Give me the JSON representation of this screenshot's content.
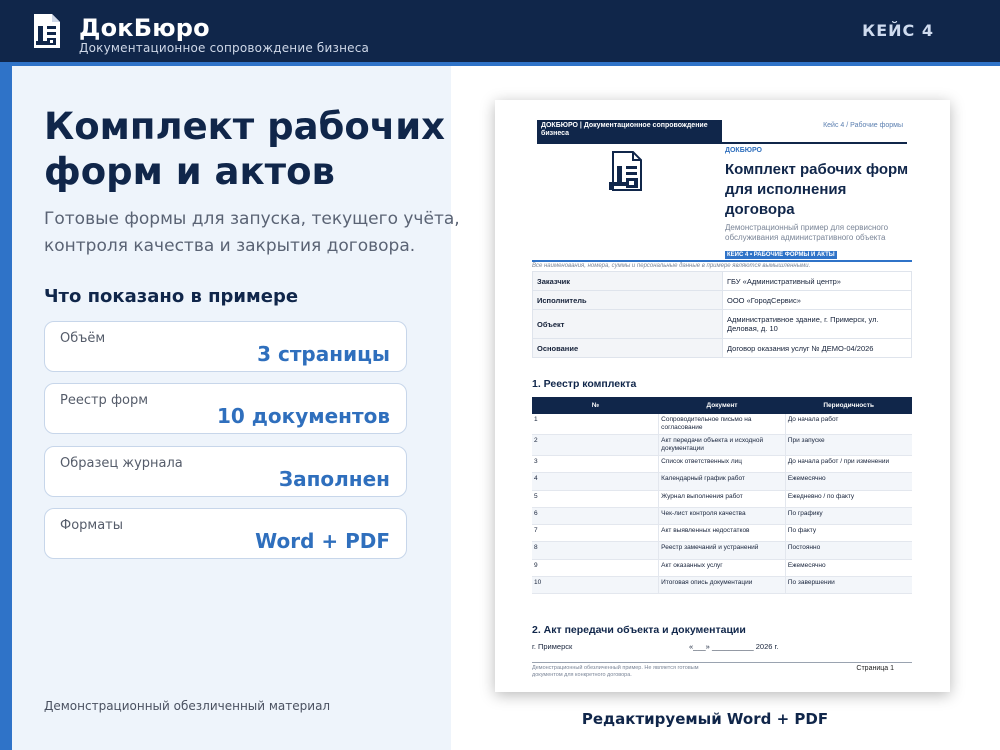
{
  "header": {
    "brand": "ДокБюро",
    "tagline": "Документационное сопровождение бизнеса",
    "case_label": "КЕЙС 4"
  },
  "left": {
    "title": "Комплект рабочих форм и актов",
    "subtitle": "Готовые формы для запуска, текущего учёта, контроля качества и закрытия договора.",
    "section_title": "Что показано в примере",
    "stats": [
      {
        "label": "Объём",
        "value": "3 страницы"
      },
      {
        "label": "Реестр форм",
        "value": "10 документов"
      },
      {
        "label": "Образец журнала",
        "value": "Заполнен"
      },
      {
        "label": "Форматы",
        "value": "Word + PDF"
      }
    ],
    "disclaimer": "Демонстрационный обезличенный материал"
  },
  "doc": {
    "header_left": "ДОКБЮРО  |  Документационное сопровождение бизнеса",
    "header_right": "Кейс 4 / Рабочие формы",
    "brand": "ДОКБЮРО",
    "title": "Комплект рабочих форм для исполнения договора",
    "subtitle": "Демонстрационный пример для сервисного обслуживания административного объекта",
    "tag": "КЕЙС 4  •  РАБОЧИЕ ФОРМЫ И АКТЫ",
    "note": "Все наименования, номера, суммы и персональные данные в примере являются вымышленными.",
    "info": [
      {
        "key": "Заказчик",
        "value": "ГБУ «Административный центр»"
      },
      {
        "key": "Исполнитель",
        "value": "ООО «ГородСервис»"
      },
      {
        "key": "Объект",
        "value": "Административное здание, г. Примерск, ул. Деловая, д. 10"
      },
      {
        "key": "Основание",
        "value": "Договор оказания услуг № ДЕМО-04/2026"
      }
    ],
    "section1_title": "1. Реестр комплекта",
    "registry_headers": [
      "№",
      "Документ",
      "Периодичность"
    ],
    "registry": [
      {
        "n": "1",
        "doc": "Сопроводительное письмо на согласование",
        "period": "До начала работ"
      },
      {
        "n": "2",
        "doc": "Акт передачи объекта и исходной документации",
        "period": "При запуске"
      },
      {
        "n": "3",
        "doc": "Список ответственных лиц",
        "period": "До начала работ / при изменении"
      },
      {
        "n": "4",
        "doc": "Календарный график работ",
        "period": "Ежемесячно"
      },
      {
        "n": "5",
        "doc": "Журнал выполнения работ",
        "period": "Ежедневно / по факту"
      },
      {
        "n": "6",
        "doc": "Чек-лист контроля качества",
        "period": "По графику"
      },
      {
        "n": "7",
        "doc": "Акт выявленных недостатков",
        "period": "По факту"
      },
      {
        "n": "8",
        "doc": "Реестр замечаний и устранений",
        "period": "Постоянно"
      },
      {
        "n": "9",
        "doc": "Акт оказанных услуг",
        "period": "Ежемесячно"
      },
      {
        "n": "10",
        "doc": "Итоговая опись документации",
        "period": "По завершении"
      }
    ],
    "section2_title": "2. Акт передачи объекта и документации",
    "city": "г. Примерск",
    "date": "«___» __________ 2026 г.",
    "footer": "Демонстрационный обезличенный пример. Не является готовым документом для конкретного договора.",
    "page": "Страница 1"
  },
  "caption": "Редактируемый Word + PDF"
}
